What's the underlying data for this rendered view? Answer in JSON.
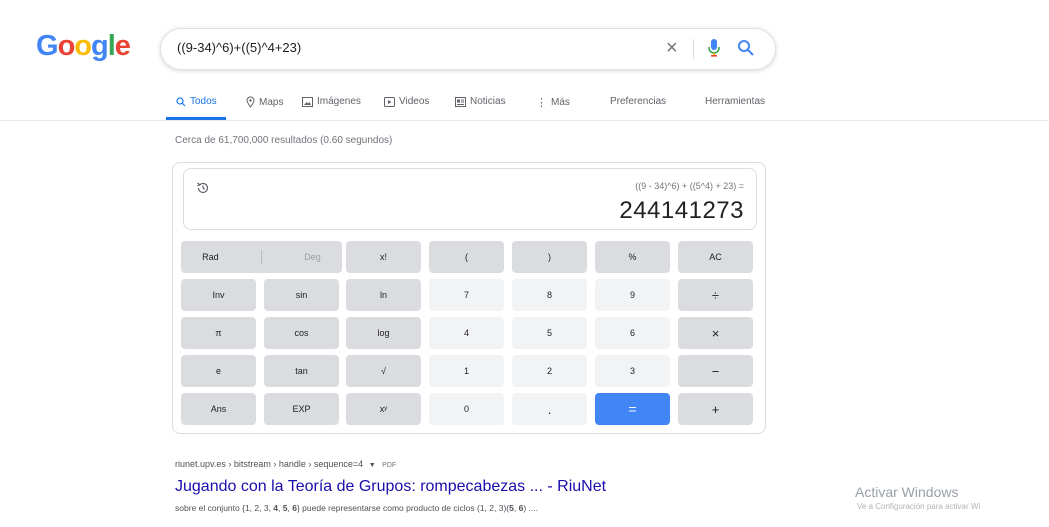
{
  "logo": {
    "letters": [
      "G",
      "o",
      "o",
      "g",
      "l",
      "e"
    ],
    "colors": [
      "#4285f4",
      "#ea4335",
      "#fbbc05",
      "#4285f4",
      "#34a853",
      "#ea4335"
    ]
  },
  "search": {
    "query": "((9-34)^6)+((5)^4+23)"
  },
  "tabs": [
    {
      "label": "Todos",
      "icon": "search-icon",
      "active": true
    },
    {
      "label": "Maps",
      "icon": "map-pin-icon"
    },
    {
      "label": "Imágenes",
      "icon": "image-icon"
    },
    {
      "label": "Videos",
      "icon": "video-icon"
    },
    {
      "label": "Noticias",
      "icon": "news-icon"
    },
    {
      "label": "Más",
      "icon": "more-vert-icon"
    },
    {
      "label": "Preferencias"
    },
    {
      "label": "Herramientas"
    }
  ],
  "stats": "Cerca de 61,700,000 resultados (0.60 segundos)",
  "calculator": {
    "expression": "((9 - 34)^6) + ((5^4) + 23) =",
    "result": "244141273",
    "rad": "Rad",
    "deg": "Deg",
    "keys": [
      [
        "x!",
        "(",
        ")",
        "%",
        "AC"
      ],
      [
        "Inv",
        "sin",
        "ln",
        "7",
        "8",
        "9",
        "÷"
      ],
      [
        "π",
        "cos",
        "log",
        "4",
        "5",
        "6",
        "×"
      ],
      [
        "e",
        "tan",
        "√",
        "1",
        "2",
        "3",
        "−"
      ],
      [
        "Ans",
        "EXP",
        "xʸ",
        "0",
        ".",
        "=",
        "+"
      ]
    ]
  },
  "result_item": {
    "cite": "riunet.upv.es › bitstream › handle › sequence=4",
    "badge": "PDF",
    "title": "Jugando con la Teoría de Grupos: rompecabezas ... - RiuNet",
    "snippet_pre": "sobre el conjunto {1, 2, 3, ",
    "snippet_b1": "4",
    "snippet_mid1": ", ",
    "snippet_b2": "5",
    "snippet_mid2": ", ",
    "snippet_b3": "6",
    "snippet_post": "} puede representarse como producto de ciclos (1, 2, 3)(",
    "snippet_b4": "5",
    "snippet_mid3": ", ",
    "snippet_b5": "6",
    "snippet_end": ") ...."
  },
  "watermark": {
    "title": "Activar Windows",
    "subtitle": "Ve a Configuración para activar Wi"
  }
}
